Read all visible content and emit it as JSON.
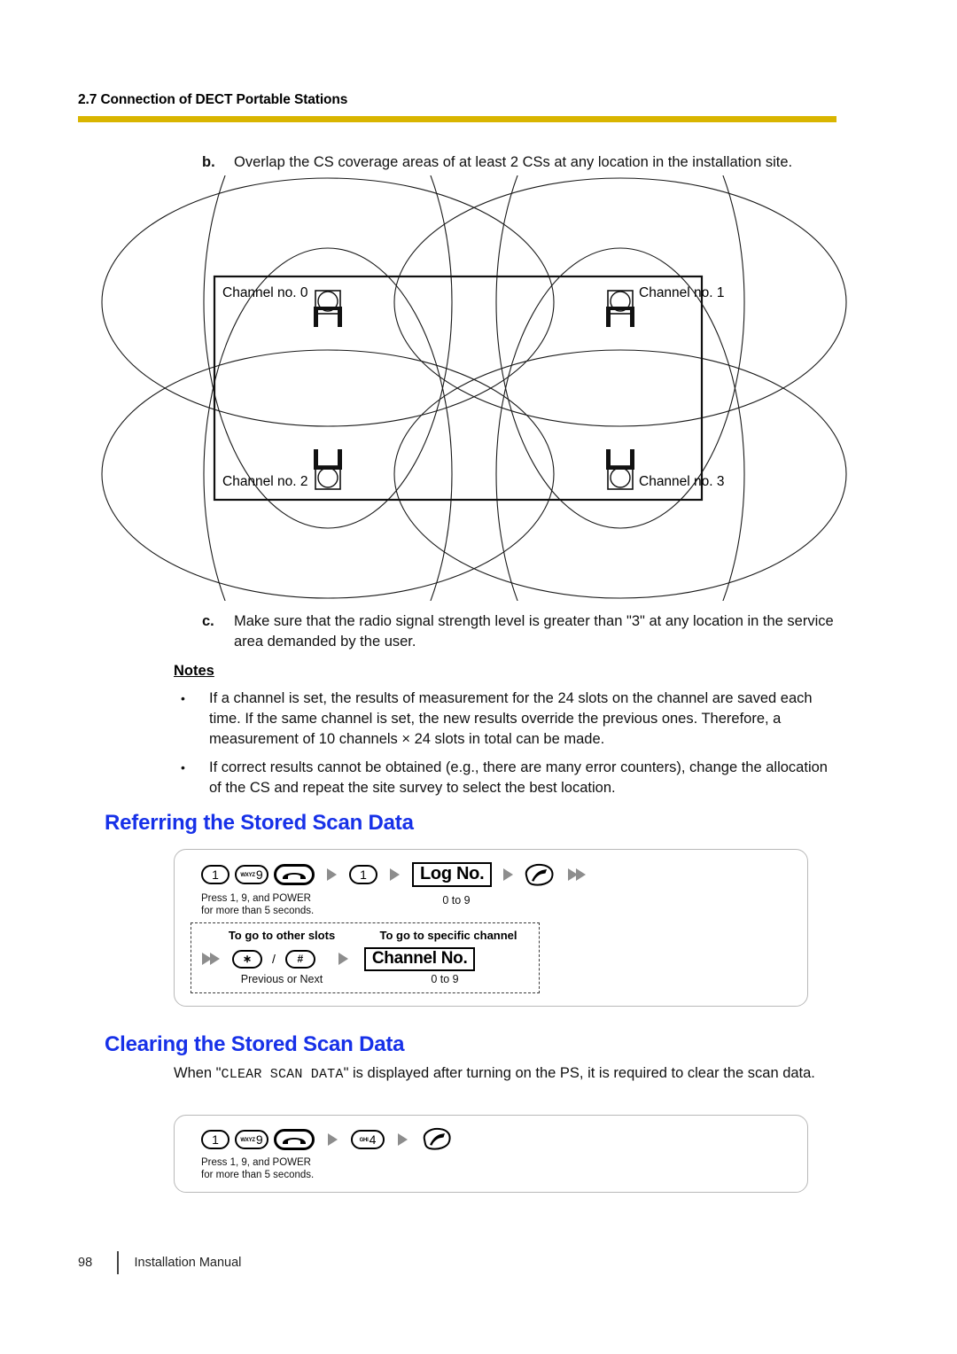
{
  "header": {
    "section_number_title": "2.7 Connection of DECT Portable Stations",
    "rule_color": "#d9b500"
  },
  "steps": {
    "b": {
      "marker": "b.",
      "text": "Overlap the CS coverage areas of at least 2 CSs at any location in the installation site."
    },
    "c": {
      "marker": "c.",
      "text": "Make sure that the radio signal strength level is greater than \"3\" at any location in the service area demanded by the user."
    }
  },
  "diagram": {
    "labels": [
      "Channel no. 0",
      "Channel no. 1",
      "Channel no. 2",
      "Channel no. 3"
    ],
    "icon_name": "cs-base-station-icon"
  },
  "notes": {
    "title": "Notes",
    "bullet": "•",
    "items": [
      "If a channel is set, the results of measurement for the 24 slots on the channel are saved each time. If the same channel is set, the new results override the previous ones. Therefore, a measurement of 10 channels × 24 slots in total can be made.",
      "If correct results cannot be obtained (e.g., there are many error counters), change the allocation of the CS and repeat the site survey to select the best location."
    ]
  },
  "referring": {
    "heading": "Referring the Stored Scan Data",
    "heading_color": "#1731e8",
    "sequence": {
      "key1": "1",
      "key9_letters": "WXYZ",
      "key9_num": "9",
      "power_icon": "power-on-hook-icon",
      "arrow1": "play-arrow-icon",
      "key1b": "1",
      "arrow2": "play-arrow-icon",
      "log_no_label": "Log No.",
      "arrow3": "play-arrow-icon",
      "talk_icon": "talk-off-hook-icon",
      "arrow4": "double-play-arrow-icon"
    },
    "caption_left": "Press 1, 9, and POWER\nfor more than 5 seconds.",
    "caption_range": "0 to 9",
    "subpanel": {
      "head_slots": "To go to other slots",
      "head_channel": "To go to specific channel",
      "arrow_in": "double-play-arrow-icon",
      "key_star": "∗",
      "separator": "/",
      "key_hash": "#",
      "arrow_mid": "play-arrow-icon",
      "channel_no_label": "Channel No.",
      "caption_left": "Previous or Next",
      "caption_right": "0 to 9"
    }
  },
  "clearing": {
    "heading": "Clearing the Stored Scan Data",
    "heading_color": "#1731e8",
    "intro_before": "When \"",
    "intro_mono": "CLEAR SCAN DATA",
    "intro_after": "\" is displayed after turning on the PS, it is required to clear the scan data.",
    "sequence": {
      "key1": "1",
      "key9_letters": "WXYZ",
      "key9_num": "9",
      "power_icon": "power-on-hook-icon",
      "arrow1": "play-arrow-icon",
      "key4_letters": "GHI",
      "key4_num": "4",
      "arrow2": "play-arrow-icon",
      "offhook_icon": "talk-off-hook-icon"
    },
    "caption_left": "Press 1, 9, and POWER\nfor more than 5 seconds."
  },
  "footer": {
    "page_number": "98",
    "manual_title": "Installation Manual"
  }
}
